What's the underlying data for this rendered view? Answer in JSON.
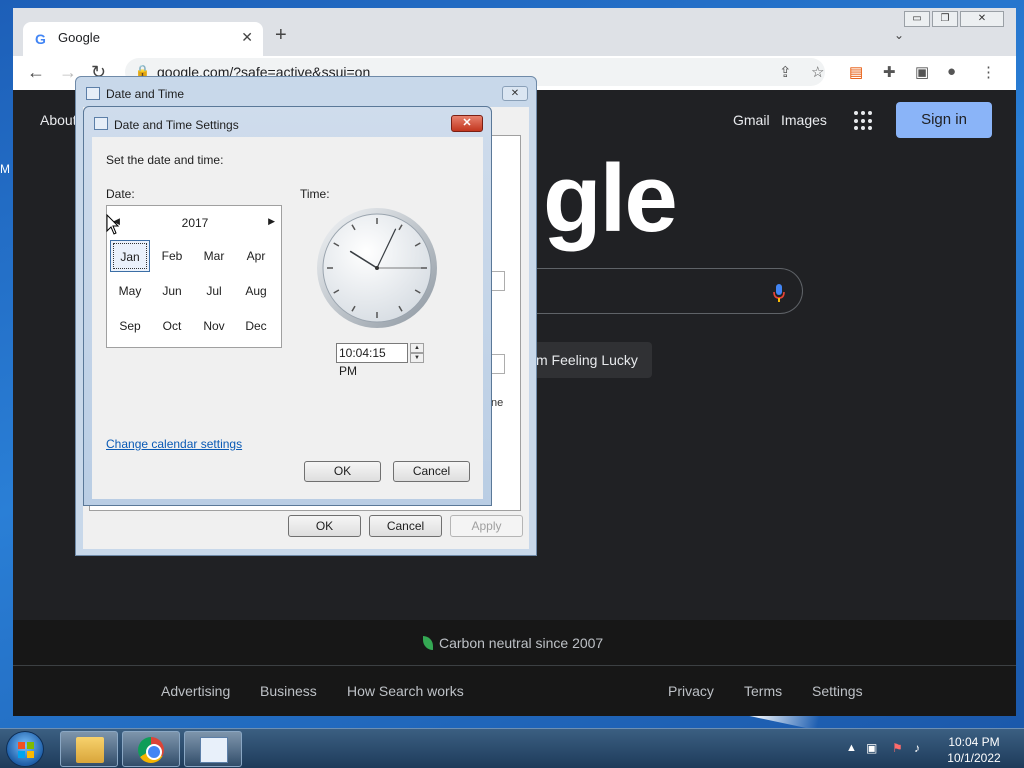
{
  "desktop": {
    "edge_letter": "M"
  },
  "chrome": {
    "tab_title": "Google",
    "tab_close": "✕",
    "new_tab": "+",
    "url": "google.com/?safe=active&ssui=on",
    "window_controls": {
      "minimize": "▭",
      "restore": "❐",
      "close": "✕"
    }
  },
  "google": {
    "about": "About",
    "gmail": "Gmail",
    "images": "Images",
    "sign_in": "Sign in",
    "logo_fragment": "gle",
    "lucky_fragment": "m Feeling Lucky",
    "carbon": "Carbon neutral since 2007",
    "footer_left": [
      "Advertising",
      "Business",
      "How Search works"
    ],
    "footer_right": [
      "Privacy",
      "Terms",
      "Settings"
    ]
  },
  "dt_outer": {
    "title": "Date and Time",
    "close": "✕",
    "peek_text": "ne",
    "buttons": {
      "ok": "OK",
      "cancel": "Cancel",
      "apply": "Apply"
    }
  },
  "dts": {
    "title": "Date and Time Settings",
    "close": "✕",
    "instruction": "Set the date and time:",
    "date_label": "Date:",
    "time_label": "Time:",
    "calendar": {
      "year": "2017",
      "prev": "◀",
      "next": "▶",
      "months": [
        "Jan",
        "Feb",
        "Mar",
        "Apr",
        "May",
        "Jun",
        "Jul",
        "Aug",
        "Sep",
        "Oct",
        "Nov",
        "Dec"
      ],
      "selected": "Jan"
    },
    "time_value": "10:04:15 PM",
    "clock": {
      "hour": 10,
      "minute": 4,
      "second": 15
    },
    "change_calendar": "Change calendar settings",
    "ok": "OK",
    "cancel": "Cancel"
  },
  "taskbar": {
    "time": "10:04 PM",
    "date": "10/1/2022",
    "tray_expand": "▲"
  }
}
